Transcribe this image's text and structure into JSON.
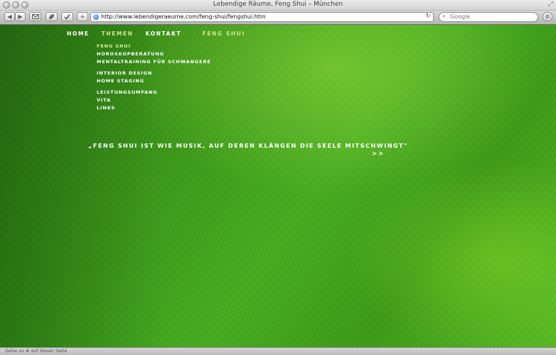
{
  "window": {
    "title": "Lebendige Räume, Feng Shui – München"
  },
  "toolbar": {
    "back_glyph": "◀",
    "forward_glyph": "▶",
    "url": "http://www.lebendigeraeume.com/feng-shui/fengshui.htm",
    "search_placeholder": "Google"
  },
  "nav": {
    "items": [
      "HOME",
      "THEMEN",
      "KONTAKT"
    ],
    "separator": "·",
    "current": "FENG SHUI"
  },
  "submenu": {
    "group1": [
      "FENG SHUI",
      "HOROSKOPBERATUNG",
      "MENTALTRAINING FÜR SCHWANGERE"
    ],
    "group2": [
      "INTERIOR DESIGN",
      "HOME STAGING"
    ],
    "group3": [
      "LEISTUNGSUMFANG",
      "VITA",
      "LINKS"
    ]
  },
  "content": {
    "quote": "„FENG SHUI IST WIE MUSIK, AUF DEREN KLÄNGEN DIE SEELE MITSCHWINGT\"",
    "more_link": ">>"
  },
  "status": {
    "text": "Gehe zu # auf dieser Seite"
  },
  "colors": {
    "accent": "#cfe88a",
    "text": "#ffffff",
    "background": "#3c9a18"
  },
  "icons": [
    "back-arrow-icon",
    "forward-arrow-icon",
    "mail-icon",
    "leaf-icon",
    "checklist-icon",
    "add-icon",
    "globe-icon",
    "reload-icon",
    "search-icon"
  ]
}
